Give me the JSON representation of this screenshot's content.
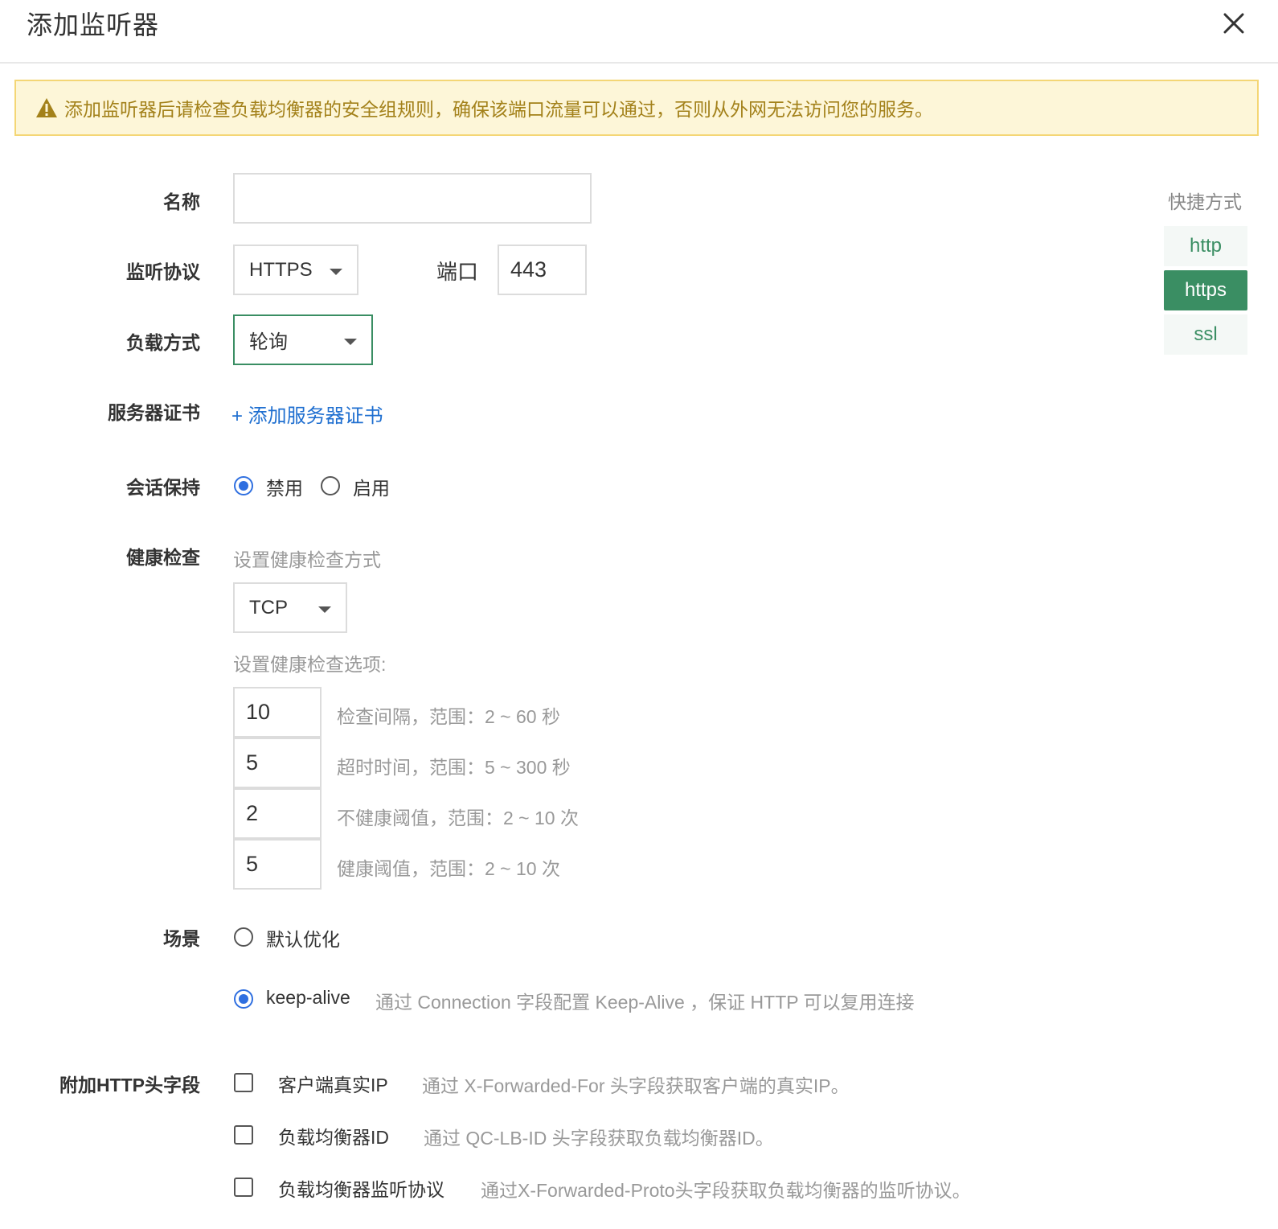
{
  "dialog": {
    "title": "添加监听器"
  },
  "alert": {
    "text": "添加监听器后请检查负载均衡器的安全组规则，确保该端口流量可以通过，否则从外网无法访问您的服务。"
  },
  "form": {
    "name": {
      "label": "名称",
      "value": ""
    },
    "protocol": {
      "label": "监听协议",
      "value": "HTTPS"
    },
    "port": {
      "label": "端口",
      "value": "443"
    },
    "balance": {
      "label": "负载方式",
      "value": "轮询"
    },
    "certificate": {
      "label": "服务器证书",
      "link": "+ 添加服务器证书"
    },
    "session": {
      "label": "会话保持",
      "options": [
        "禁用",
        "启用"
      ],
      "selected": "禁用"
    },
    "health": {
      "label": "健康检查",
      "method_hint": "设置健康检查方式",
      "method": "TCP",
      "options_hint": "设置健康检查选项:",
      "options": [
        {
          "value": "10",
          "desc": "检查间隔，范围：2 ~ 60 秒"
        },
        {
          "value": "5",
          "desc": "超时时间，范围：5 ~ 300 秒"
        },
        {
          "value": "2",
          "desc": "不健康阈值，范围：2 ~ 10 次"
        },
        {
          "value": "5",
          "desc": "健康阈值，范围：2 ~ 10 次"
        }
      ]
    },
    "scene": {
      "label": "场景",
      "options": [
        {
          "label": "默认优化",
          "desc": ""
        },
        {
          "label": "keep-alive",
          "desc": "通过 Connection 字段配置 Keep-Alive ，保证 HTTP 可以复用连接"
        }
      ],
      "selected": "keep-alive"
    },
    "headers": {
      "label": "附加HTTP头字段",
      "items": [
        {
          "label": "客户端真实IP",
          "desc": "通过 X-Forwarded-For 头字段获取客户端的真实IP。"
        },
        {
          "label": "负载均衡器ID",
          "desc": "通过 QC-LB-ID 头字段获取负载均衡器ID。"
        },
        {
          "label": "负载均衡器监听协议",
          "desc": "通过X-Forwarded-Proto头字段获取负载均衡器的监听协议。"
        }
      ]
    }
  },
  "shortcuts": {
    "title": "快捷方式",
    "items": [
      "http",
      "https",
      "ssl"
    ],
    "active": "https"
  },
  "colors": {
    "accent": "#3a8e63",
    "radio": "#2f6fe0",
    "warning_bg": "#fdf6d8",
    "warning_text": "#a3811a"
  }
}
